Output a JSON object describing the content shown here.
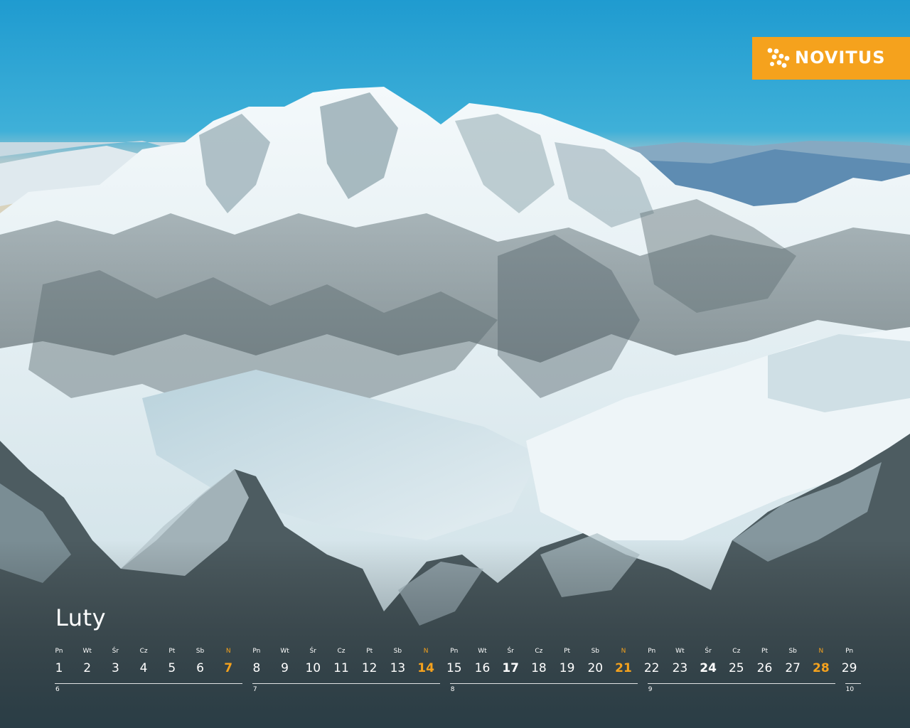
{
  "brand": {
    "name": "NOVITUS",
    "color": "#f5a21d"
  },
  "month": "Luty",
  "weekdays": [
    "Pn",
    "Wt",
    "Śr",
    "Cz",
    "Pt",
    "Sb",
    "N"
  ],
  "days": [
    {
      "d": "1",
      "wd": "Pn"
    },
    {
      "d": "2",
      "wd": "Wt"
    },
    {
      "d": "3",
      "wd": "Śr"
    },
    {
      "d": "4",
      "wd": "Cz"
    },
    {
      "d": "5",
      "wd": "Pt"
    },
    {
      "d": "6",
      "wd": "Sb"
    },
    {
      "d": "7",
      "wd": "N",
      "sun": true
    },
    {
      "d": "8",
      "wd": "Pn"
    },
    {
      "d": "9",
      "wd": "Wt"
    },
    {
      "d": "10",
      "wd": "Śr"
    },
    {
      "d": "11",
      "wd": "Cz"
    },
    {
      "d": "12",
      "wd": "Pt"
    },
    {
      "d": "13",
      "wd": "Sb"
    },
    {
      "d": "14",
      "wd": "N",
      "sun": true
    },
    {
      "d": "15",
      "wd": "Pn"
    },
    {
      "d": "16",
      "wd": "Wt"
    },
    {
      "d": "17",
      "wd": "Śr",
      "bold": true
    },
    {
      "d": "18",
      "wd": "Cz"
    },
    {
      "d": "19",
      "wd": "Pt"
    },
    {
      "d": "20",
      "wd": "Sb"
    },
    {
      "d": "21",
      "wd": "N",
      "sun": true
    },
    {
      "d": "22",
      "wd": "Pn"
    },
    {
      "d": "23",
      "wd": "Wt"
    },
    {
      "d": "24",
      "wd": "Śr",
      "bold": true
    },
    {
      "d": "25",
      "wd": "Cz"
    },
    {
      "d": "26",
      "wd": "Pt"
    },
    {
      "d": "27",
      "wd": "Sb"
    },
    {
      "d": "28",
      "wd": "N",
      "sun": true
    },
    {
      "d": "29",
      "wd": "Pn"
    }
  ],
  "week_numbers": [
    "6",
    "7",
    "8",
    "9",
    "10"
  ],
  "colors": {
    "sky": "#2a9fcf",
    "snow": "#eef4f7",
    "rock": "#5d6c70",
    "accent": "#f5a21d"
  }
}
